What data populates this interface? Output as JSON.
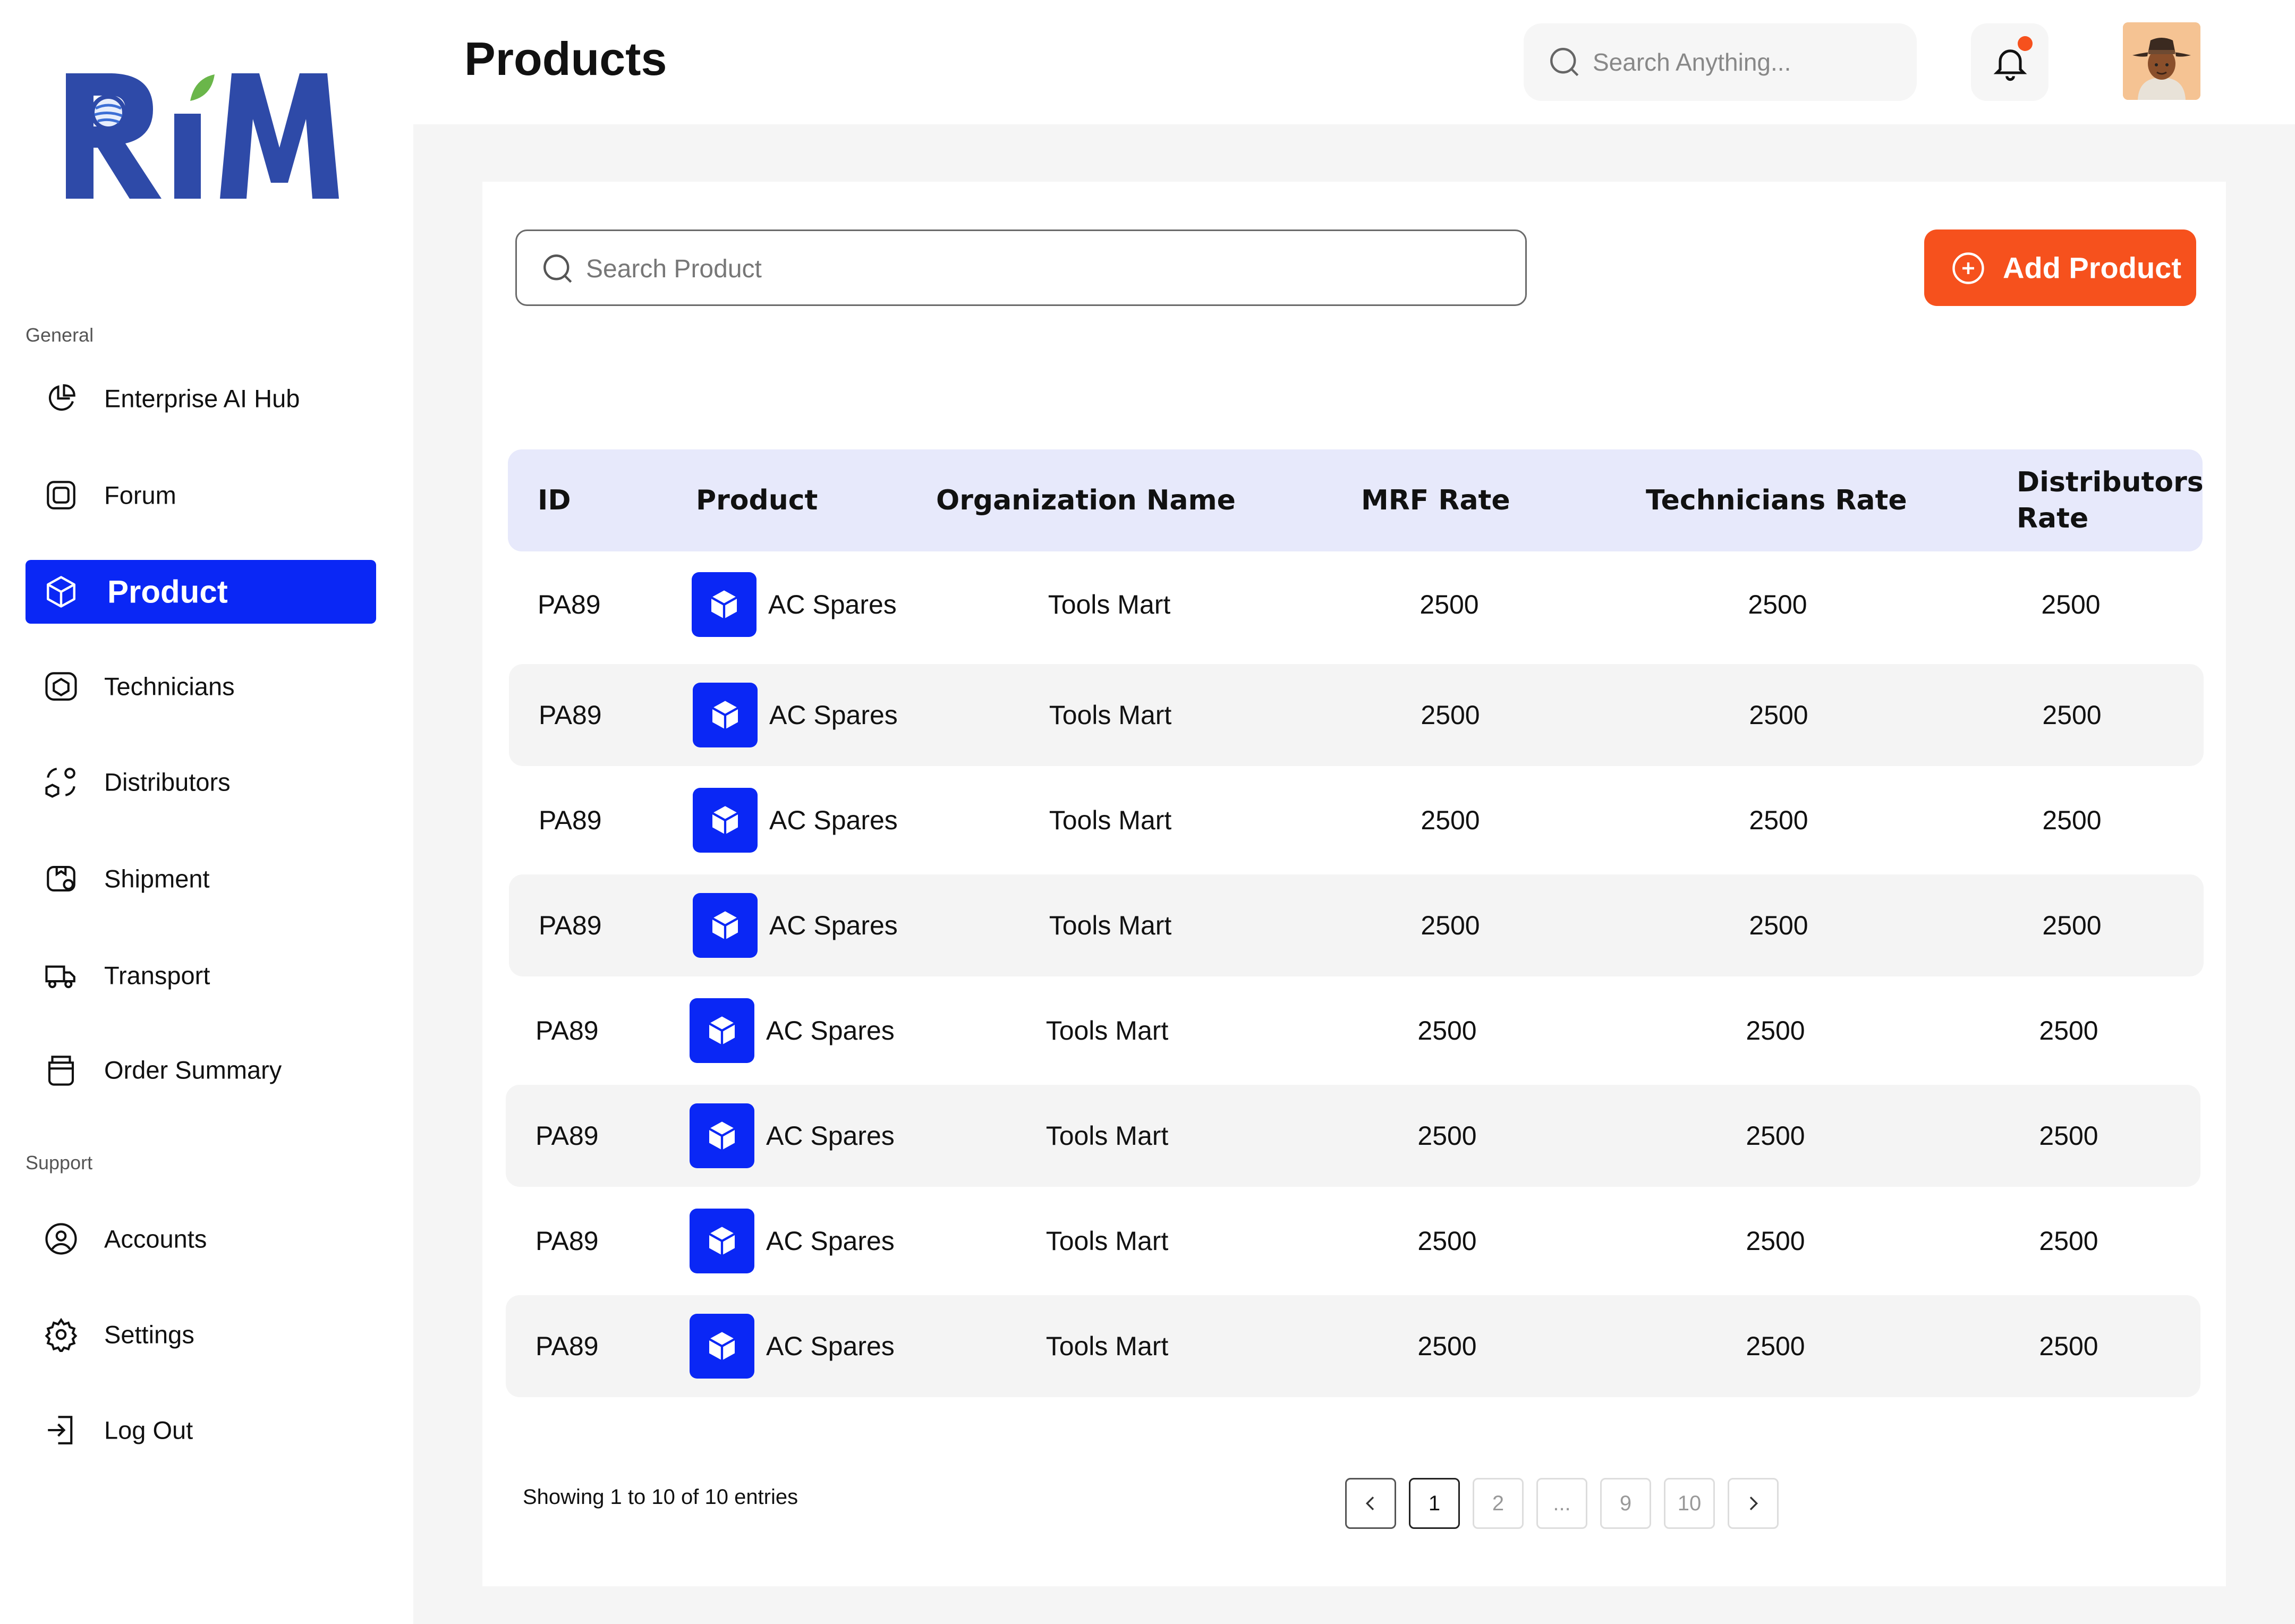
{
  "brand": {
    "logo_text": "RiM"
  },
  "sidebar": {
    "general_label": "General",
    "support_label": "Support",
    "general_items": [
      {
        "label": "Enterprise AI Hub",
        "icon": "pie-chart-icon"
      },
      {
        "label": "Forum",
        "icon": "forum-icon"
      },
      {
        "label": "Product",
        "icon": "cube-icon",
        "active": true
      },
      {
        "label": "Technicians",
        "icon": "technician-icon"
      },
      {
        "label": "Distributors",
        "icon": "distributors-icon"
      },
      {
        "label": "Shipment",
        "icon": "shipment-icon"
      },
      {
        "label": "Transport",
        "icon": "truck-icon"
      },
      {
        "label": "Order Summary",
        "icon": "order-icon"
      }
    ],
    "support_items": [
      {
        "label": "Accounts",
        "icon": "user-circle-icon"
      },
      {
        "label": "Settings",
        "icon": "gear-icon"
      },
      {
        "label": "Log Out",
        "icon": "logout-icon"
      }
    ]
  },
  "header": {
    "title": "Products",
    "search_placeholder": "Search Anything...",
    "notification_icon": "bell-icon",
    "has_notification_dot": true
  },
  "toolbar": {
    "search_placeholder": "Search Product",
    "add_label": "Add Product"
  },
  "table": {
    "columns": [
      "ID",
      "Product",
      "Organization Name",
      "MRF Rate",
      "Technicians Rate",
      "Distributors Rate"
    ],
    "rows": [
      {
        "id": "PA89",
        "product": "AC Spares",
        "org": "Tools Mart",
        "mrf": "2500",
        "tech": "2500",
        "dist": "2500"
      },
      {
        "id": "PA89",
        "product": "AC Spares",
        "org": "Tools Mart",
        "mrf": "2500",
        "tech": "2500",
        "dist": "2500"
      },
      {
        "id": "PA89",
        "product": "AC Spares",
        "org": "Tools Mart",
        "mrf": "2500",
        "tech": "2500",
        "dist": "2500"
      },
      {
        "id": "PA89",
        "product": "AC Spares",
        "org": "Tools Mart",
        "mrf": "2500",
        "tech": "2500",
        "dist": "2500"
      },
      {
        "id": "PA89",
        "product": "AC Spares",
        "org": "Tools Mart",
        "mrf": "2500",
        "tech": "2500",
        "dist": "2500"
      },
      {
        "id": "PA89",
        "product": "AC Spares",
        "org": "Tools Mart",
        "mrf": "2500",
        "tech": "2500",
        "dist": "2500"
      },
      {
        "id": "PA89",
        "product": "AC Spares",
        "org": "Tools Mart",
        "mrf": "2500",
        "tech": "2500",
        "dist": "2500"
      },
      {
        "id": "PA89",
        "product": "AC Spares",
        "org": "Tools Mart",
        "mrf": "2500",
        "tech": "2500",
        "dist": "2500"
      }
    ]
  },
  "footer": {
    "showing_text": "Showing 1 to 10 of 10 entries",
    "pages": [
      "1",
      "2",
      "...",
      "9",
      "10"
    ],
    "current_page": "1"
  },
  "colors": {
    "accent": "#0a27f5",
    "add_button": "#f6511d",
    "table_header": "#e7e9fb",
    "row_shade": "#f4f4f4",
    "content_bg": "#f5f5f5"
  }
}
